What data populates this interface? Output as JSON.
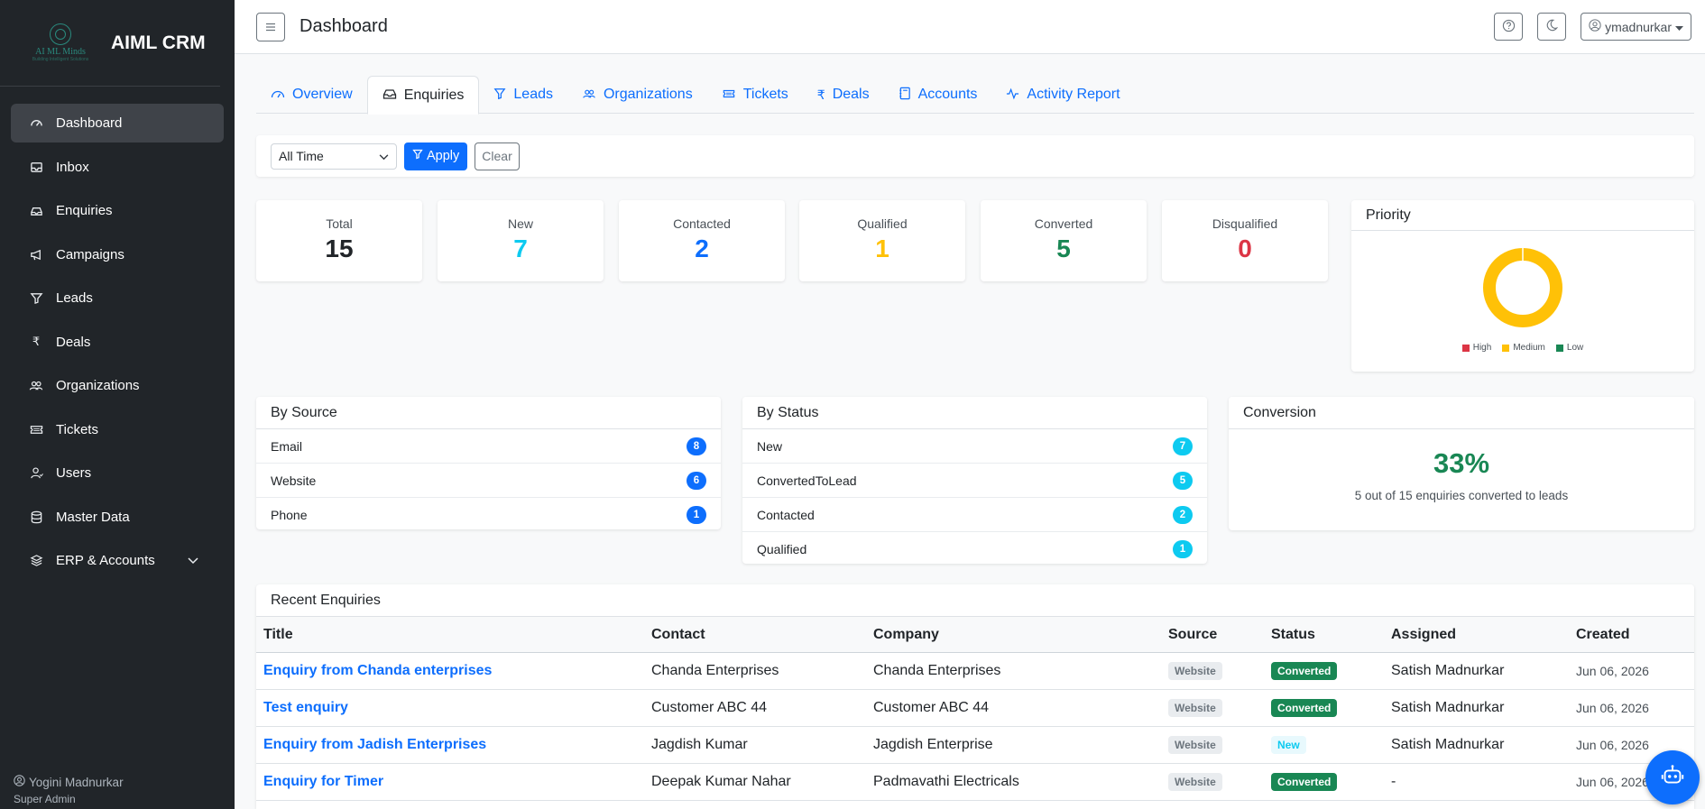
{
  "app": {
    "logo_text": "AI ML Minds",
    "logo_sub": "Building Intelligent Solutions",
    "name": "AIML CRM"
  },
  "sidebar": {
    "items": [
      {
        "label": "Dashboard",
        "icon": "dashboard-icon",
        "active": true
      },
      {
        "label": "Inbox",
        "icon": "inbox-icon"
      },
      {
        "label": "Enquiries",
        "icon": "enquiries-icon"
      },
      {
        "label": "Campaigns",
        "icon": "megaphone-icon"
      },
      {
        "label": "Leads",
        "icon": "funnel-icon"
      },
      {
        "label": "Deals",
        "icon": "rupee-icon"
      },
      {
        "label": "Organizations",
        "icon": "people-icon"
      },
      {
        "label": "Tickets",
        "icon": "ticket-icon"
      },
      {
        "label": "Users",
        "icon": "user-icon"
      },
      {
        "label": "Master Data",
        "icon": "database-icon"
      },
      {
        "label": "ERP & Accounts",
        "icon": "stack-icon",
        "expandable": true
      }
    ],
    "user_name": "Yogini Madnurkar",
    "user_role": "Super Admin"
  },
  "header": {
    "title": "Dashboard",
    "username": "ymadnurkar"
  },
  "tabs": [
    {
      "label": "Overview",
      "icon": "speedometer-icon"
    },
    {
      "label": "Enquiries",
      "icon": "inbox-tray-icon",
      "active": true
    },
    {
      "label": "Leads",
      "icon": "funnel-icon"
    },
    {
      "label": "Organizations",
      "icon": "people-icon"
    },
    {
      "label": "Tickets",
      "icon": "ticket-icon"
    },
    {
      "label": "Deals",
      "icon": "rupee-icon"
    },
    {
      "label": "Accounts",
      "icon": "journal-icon"
    },
    {
      "label": "Activity Report",
      "icon": "activity-icon"
    }
  ],
  "filter": {
    "period": "All Time",
    "apply_label": "Apply",
    "clear_label": "Clear"
  },
  "stats": [
    {
      "label": "Total",
      "value": "15",
      "color": "#212529"
    },
    {
      "label": "New",
      "value": "7",
      "color": "#0dcaf0"
    },
    {
      "label": "Contacted",
      "value": "2",
      "color": "#0d6efd"
    },
    {
      "label": "Qualified",
      "value": "1",
      "color": "#ffc107"
    },
    {
      "label": "Converted",
      "value": "5",
      "color": "#198754"
    },
    {
      "label": "Disqualified",
      "value": "0",
      "color": "#dc3545"
    }
  ],
  "priority": {
    "title": "Priority",
    "legend": [
      {
        "label": "High",
        "color": "#dc3545"
      },
      {
        "label": "Medium",
        "color": "#ffc107"
      },
      {
        "label": "Low",
        "color": "#198754"
      }
    ],
    "chart_data": {
      "type": "pie",
      "categories": [
        "High",
        "Medium",
        "Low"
      ],
      "values": [
        0,
        15,
        0
      ]
    }
  },
  "by_source": {
    "title": "By Source",
    "rows": [
      {
        "label": "Email",
        "count": "8"
      },
      {
        "label": "Website",
        "count": "6"
      },
      {
        "label": "Phone",
        "count": "1"
      }
    ],
    "badge_color": "#0d6efd"
  },
  "by_status": {
    "title": "By Status",
    "rows": [
      {
        "label": "New",
        "count": "7"
      },
      {
        "label": "ConvertedToLead",
        "count": "5"
      },
      {
        "label": "Contacted",
        "count": "2"
      },
      {
        "label": "Qualified",
        "count": "1"
      }
    ],
    "badge_color": "#0dcaf0"
  },
  "conversion": {
    "title": "Conversion",
    "percent": "33%",
    "caption": "5 out of 15 enquiries converted to leads"
  },
  "recent": {
    "title": "Recent Enquiries",
    "columns": [
      "Title",
      "Contact",
      "Company",
      "Source",
      "Status",
      "Assigned",
      "Created"
    ],
    "rows": [
      {
        "title": "Enquiry from Chanda enterprises",
        "contact": "Chanda Enterprises",
        "company": "Chanda Enterprises",
        "source": "Website",
        "status": "Converted",
        "assigned": "Satish Madnurkar",
        "created": "Jun 06, 2026"
      },
      {
        "title": "Test enquiry",
        "contact": "Customer ABC 44",
        "company": "Customer ABC 44",
        "source": "Website",
        "status": "Converted",
        "assigned": "Satish Madnurkar",
        "created": "Jun 06, 2026"
      },
      {
        "title": "Enquiry from Jadish Enterprises",
        "contact": "Jagdish Kumar",
        "company": "Jagdish Enterprise",
        "source": "Website",
        "status": "New",
        "assigned": "Satish Madnurkar",
        "created": "Jun 06, 2026"
      },
      {
        "title": "Enquiry for Timer",
        "contact": "Deepak Kumar Nahar",
        "company": "Padmavathi Electricals",
        "source": "Website",
        "status": "Converted",
        "assigned": "-",
        "created": "Jun 06, 2026"
      }
    ]
  }
}
